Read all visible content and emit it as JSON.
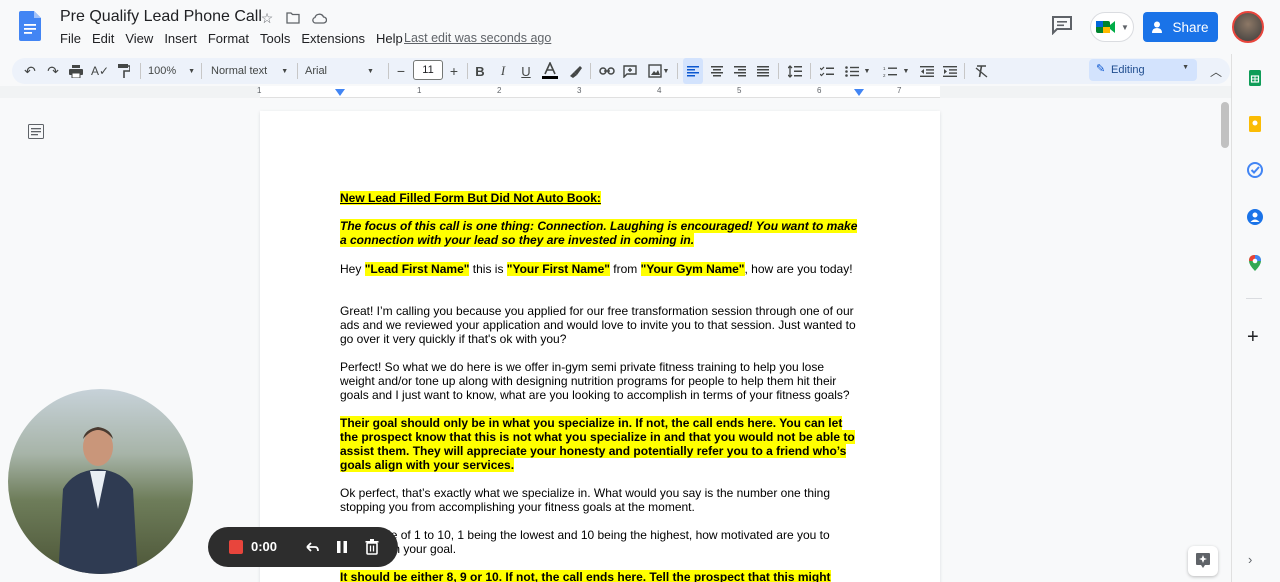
{
  "header": {
    "doc_title": "Pre Qualify Lead Phone Call",
    "menus": [
      "File",
      "Edit",
      "View",
      "Insert",
      "Format",
      "Tools",
      "Extensions",
      "Help"
    ],
    "last_edit": "Last edit was seconds ago",
    "share_label": "Share"
  },
  "toolbar": {
    "zoom": "100%",
    "style": "Normal text",
    "font": "Arial",
    "font_size": "11",
    "mode": "Editing"
  },
  "ruler": [
    "1",
    "1",
    "2",
    "3",
    "4",
    "5",
    "6",
    "7"
  ],
  "doc": {
    "heading": "New Lead Filled Form But Did Not Auto Book:",
    "focus": "The focus of this call is one thing: Connection. Laughing is encouraged! You want to make a connection with your lead so they are invested in coming in.",
    "greet_1": "Hey ",
    "greet_lead": "\"Lead First Name\"",
    "greet_2": " this is ",
    "greet_you": "\"Your First Name\"",
    "greet_3": " from ",
    "greet_gym": "\"Your Gym Name\"",
    "greet_4": ", how are you today!",
    "p_great": "Great! I’m calling you because you applied for our free transformation session through one of our ads and we reviewed your application and would love to invite you to that session. Just wanted to go over it very quickly if that's ok with you?",
    "p_perfect": "Perfect! So what we do here is we offer in-gym semi private fitness training to help you lose weight and/or tone up along with designing nutrition programs for people to help them hit their goals and I just want to know, what are you looking to accomplish in terms of your fitness goals?",
    "p_goal": "Their goal should only be in what you specialize in. If not, the call ends here. You can let the prospect know that this is not what you specialize in and that you would not be able to assist them. They will appreciate your honesty and potentially refer you to a friend who’s goals align with your services.",
    "p_ok": "Ok perfect, that’s exactly what we specialize in. What would you say is the number one thing stopping you from accomplishing your fitness goals at the moment.",
    "p_scale": "On a scale of 1 to 10, 1 being the lowest and 10 being the highest, how motivated are you to accomplish your goal.",
    "p_last": "It should be either 8, 9 or 10. If not, the call ends here. Tell the prospect that this might"
  },
  "recorder": {
    "time": "0:00"
  },
  "colors": {
    "highlight": "#ffff00",
    "accent": "#1a73e8",
    "record": "#e8453c"
  }
}
